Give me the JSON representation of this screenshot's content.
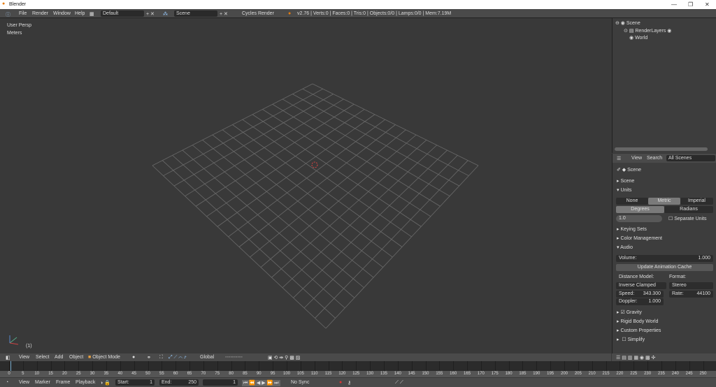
{
  "window": {
    "title": "Blender"
  },
  "menu": {
    "items": [
      "File",
      "Render",
      "Window",
      "Help"
    ],
    "layout": "Default",
    "scene": "Scene",
    "engine": "Cycles Render",
    "stats": "v2.76 | Verts:0 | Faces:0 | Tris:0 | Objects:0/0 | Lamps:0/0 | Mem:7.19M"
  },
  "viewport": {
    "view_name": "User Persp",
    "units": "Meters",
    "frame_label": "(1)"
  },
  "outliner": {
    "items": [
      "Scene",
      "RenderLayers",
      "World"
    ]
  },
  "properties": {
    "header": {
      "view": "View",
      "search": "Search",
      "filter": "All Scenes"
    },
    "context": "Scene",
    "panels": {
      "scene": "Scene",
      "units": "Units",
      "keying": "Keying Sets",
      "color": "Color Management",
      "audio": "Audio",
      "gravity": "Gravity",
      "rigid": "Rigid Body World",
      "custom": "Custom Properties",
      "simplify": "Simplify"
    },
    "unit_system": [
      "None",
      "Metric",
      "Imperial"
    ],
    "rotation": [
      "Degrees",
      "Radians"
    ],
    "scale": "1.0",
    "separate_units": "Separate Units",
    "volume_label": "Volume:",
    "volume": "1.000",
    "update_cache": "Update Animation Cache",
    "distance_model_label": "Distance Model:",
    "distance_model": "Inverse Clamped",
    "format_label": "Format:",
    "format": "Stereo",
    "speed_label": "Speed:",
    "speed": "343.300",
    "rate_label": "Rate:",
    "rate": "44100",
    "doppler_label": "Doppler:",
    "doppler": "1.000"
  },
  "view3d_header": {
    "items": [
      "View",
      "Select",
      "Add",
      "Object"
    ],
    "mode": "Object Mode",
    "orientation": "Global"
  },
  "timeline": {
    "items": [
      "View",
      "Marker",
      "Frame",
      "Playback"
    ],
    "start_label": "Start:",
    "start": "1",
    "end_label": "End:",
    "end": "250",
    "current": "1",
    "sync": "No Sync",
    "ticks": [
      0,
      5,
      10,
      15,
      20,
      25,
      30,
      35,
      40,
      45,
      50,
      55,
      60,
      65,
      70,
      75,
      80,
      85,
      90,
      95,
      100,
      105,
      110,
      115,
      120,
      125,
      130,
      135,
      140,
      145,
      150,
      155,
      160,
      165,
      170,
      175,
      180,
      185,
      190,
      195,
      200,
      205,
      210,
      215,
      220,
      225,
      230,
      235,
      240,
      245,
      250
    ]
  }
}
